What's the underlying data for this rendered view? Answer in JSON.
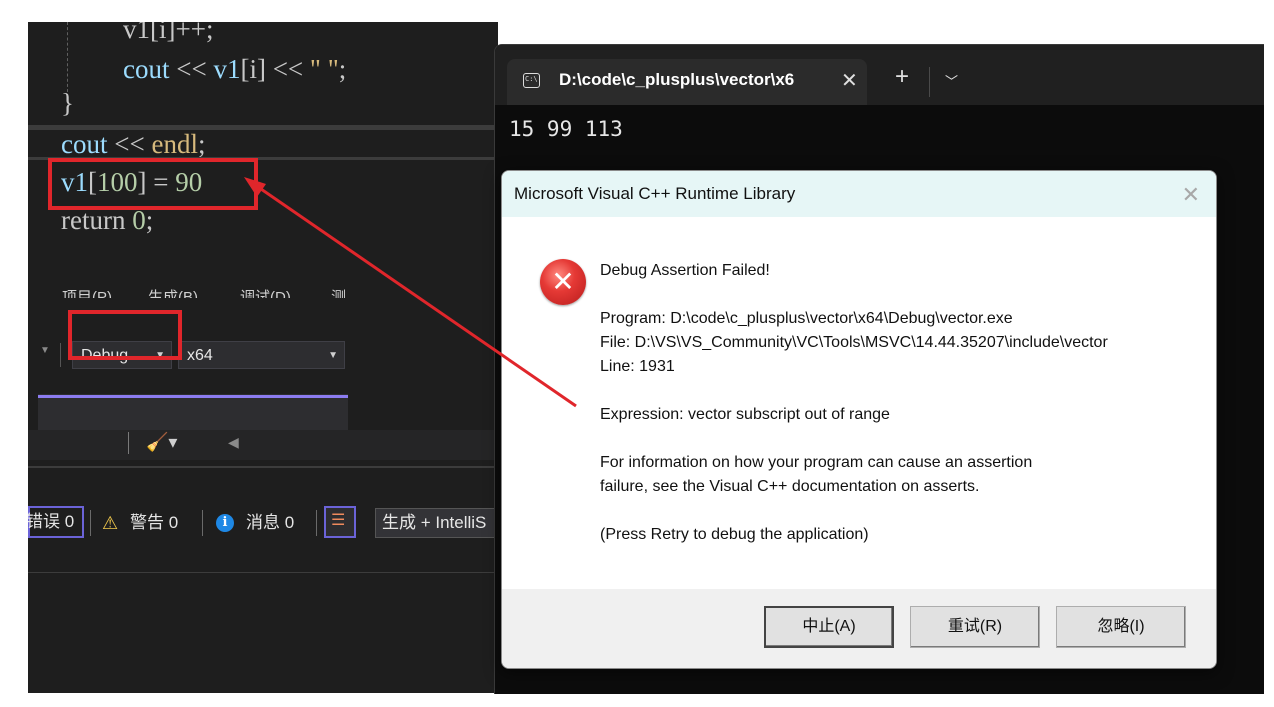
{
  "code_lines": {
    "line1": "v1[i]++;",
    "line2": "cout << v1[i] << \" \";",
    "line3": "}",
    "line4": "cout << endl;",
    "line5": "v1[100] = 90",
    "line6": "return 0;"
  },
  "menu": {
    "items": [
      "项目(P)",
      "生成(B)",
      "调试(D)",
      "测"
    ]
  },
  "toolbar": {
    "config_value": "Debug",
    "platform_value": "x64"
  },
  "error_list": {
    "errors_label": "错误 0",
    "warnings_label": "警告 0",
    "messages_label": "消息 0",
    "scope_value": "生成 + IntelliS",
    "left_fragment": "错"
  },
  "terminal": {
    "tab_title": "D:\\code\\c_plusplus\\vector\\x6",
    "output": "15 99 113"
  },
  "dialog": {
    "title": "Microsoft Visual C++ Runtime Library",
    "heading": "Debug Assertion Failed!",
    "program": "Program: D:\\code\\c_plusplus\\vector\\x64\\Debug\\vector.exe",
    "file": "File: D:\\VS\\VS_Community\\VC\\Tools\\MSVC\\14.44.35207\\include\\vector",
    "line": "Line: 1931",
    "expression": "Expression: vector subscript out of range",
    "info1": "For information on how your program can cause an assertion",
    "info2": "failure, see the Visual C++ documentation on asserts.",
    "press": "(Press Retry to debug the application)",
    "buttons": {
      "abort": "中止(A)",
      "retry": "重试(R)",
      "ignore": "忽略(I)"
    }
  },
  "colors": {
    "annotation_red": "#e0262b",
    "ide_bg": "#1e1e1e",
    "terminal_bg": "#0c0c0c",
    "dialog_title_bg": "#e6f6f6"
  }
}
